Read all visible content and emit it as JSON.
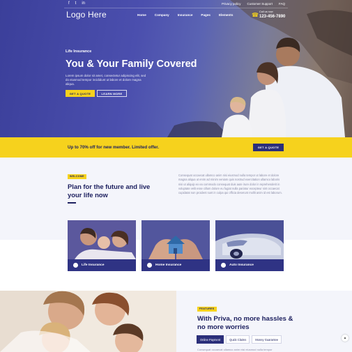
{
  "topbar": {
    "social": [
      "f",
      "t",
      "in"
    ],
    "links": [
      "Privacy policy",
      "Customer Support",
      "FAQ"
    ]
  },
  "header": {
    "logo": "Logo Here",
    "nav": [
      "Home",
      "Company",
      "Insurance",
      "Pages",
      "Elements"
    ],
    "phone_caption": "Call us now",
    "phone_number": "123-456-7890"
  },
  "hero": {
    "kicker": "Life Insurance",
    "title": "You & Your Family Covered",
    "text": "Lorem ipsum dolor sit amet, consectetur adipiscing elit, sed do eiusmod tempor incididunt ut labore et dolore magna aliqua.",
    "primary_btn": "GET A QUOTE",
    "secondary_btn": "LEARN MORE"
  },
  "promo": {
    "text": "Up to 70% off for new member. Limited offer.",
    "btn": "GET A QUOTE"
  },
  "plan": {
    "tag": "WELCOME",
    "title": "Plan for the future and live your life now",
    "text": "Consequat occaecat ullamco anim nisi eiusmod nulla tempor ut labore et dolore magna aliqua ut enim ad minim veniam quis nostrud exercitation ullamco laboris nisi ut aliquip ex ea commodo consequat duis aute irure dolor in reprehenderit in voluptate velit esse cillum dolore eu fugiat nulla pariatur excepteur sint occaecat cupidatat non proident sunt in culpa qui officia deserunt mollit anim id est laborum."
  },
  "cards": [
    {
      "label": "Life Insurance"
    },
    {
      "label": "Home Insurance"
    },
    {
      "label": "Auto Insurance"
    }
  ],
  "features": {
    "tag": "FEATURES",
    "title": "With Priva, no more hassles & no more worries",
    "tabs": [
      "Online Payment",
      "Quick Claims",
      "Money Guarantee"
    ],
    "text": "Consequat occaecat ullamco anim nisi eiusmod nulla tempor"
  },
  "colors": {
    "navy": "#2b2f7a",
    "yellow": "#f6d21d",
    "hero_blue": "#4b4fae"
  }
}
